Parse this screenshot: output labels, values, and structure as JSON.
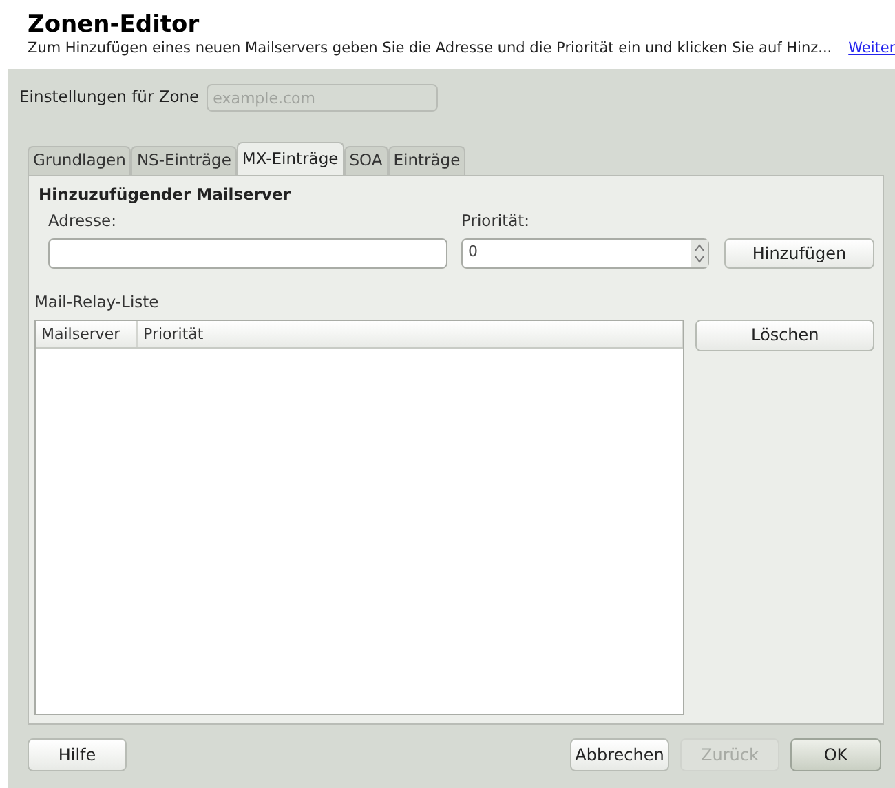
{
  "header": {
    "title": "Zonen-Editor",
    "description": "Zum Hinzufügen eines neuen Mailservers geben Sie die Adresse und die Priorität ein und klicken Sie auf Hinz...",
    "link": "Weiter"
  },
  "zone": {
    "label": "Einstellungen für Zone",
    "placeholder": "example.com"
  },
  "tabs": [
    {
      "label": "Grundlagen",
      "selected": false
    },
    {
      "label": "NS-Einträge",
      "selected": false
    },
    {
      "label": "MX-Einträge",
      "selected": true
    },
    {
      "label": "SOA",
      "selected": false
    },
    {
      "label": "Einträge",
      "selected": false
    }
  ],
  "add_group": {
    "title": "Hinzuzufügender Mailserver",
    "address_label": "Adresse:",
    "priority_label": "Priorität:",
    "priority_value": "0",
    "add_button": "Hinzufügen"
  },
  "relay_list": {
    "title": "Mail-Relay-Liste",
    "columns": [
      "Mailserver",
      "Priorität"
    ],
    "delete_button": "Löschen"
  },
  "buttons": [
    {
      "label": "Hilfe",
      "disabled": false,
      "kind": "left"
    },
    {
      "label": "Abbrechen",
      "disabled": false,
      "kind": "right"
    },
    {
      "label": "Zurück",
      "disabled": true,
      "kind": "right"
    },
    {
      "label": "OK",
      "disabled": false,
      "kind": "default"
    }
  ]
}
